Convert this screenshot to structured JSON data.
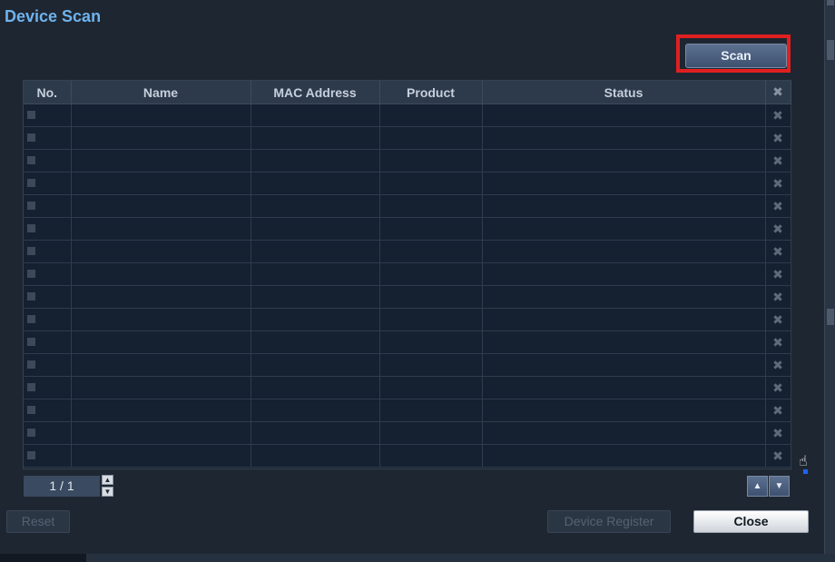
{
  "window": {
    "title": "Device Scan"
  },
  "toolbar": {
    "scan_label": "Scan"
  },
  "table": {
    "headers": {
      "no": "No.",
      "name": "Name",
      "mac": "MAC Address",
      "product": "Product",
      "status": "Status",
      "delete": "✖"
    },
    "rows": [
      {
        "no": "",
        "name": "",
        "mac": "",
        "product": "",
        "status": ""
      },
      {
        "no": "",
        "name": "",
        "mac": "",
        "product": "",
        "status": ""
      },
      {
        "no": "",
        "name": "",
        "mac": "",
        "product": "",
        "status": ""
      },
      {
        "no": "",
        "name": "",
        "mac": "",
        "product": "",
        "status": ""
      },
      {
        "no": "",
        "name": "",
        "mac": "",
        "product": "",
        "status": ""
      },
      {
        "no": "",
        "name": "",
        "mac": "",
        "product": "",
        "status": ""
      },
      {
        "no": "",
        "name": "",
        "mac": "",
        "product": "",
        "status": ""
      },
      {
        "no": "",
        "name": "",
        "mac": "",
        "product": "",
        "status": ""
      },
      {
        "no": "",
        "name": "",
        "mac": "",
        "product": "",
        "status": ""
      },
      {
        "no": "",
        "name": "",
        "mac": "",
        "product": "",
        "status": ""
      },
      {
        "no": "",
        "name": "",
        "mac": "",
        "product": "",
        "status": ""
      },
      {
        "no": "",
        "name": "",
        "mac": "",
        "product": "",
        "status": ""
      },
      {
        "no": "",
        "name": "",
        "mac": "",
        "product": "",
        "status": ""
      },
      {
        "no": "",
        "name": "",
        "mac": "",
        "product": "",
        "status": ""
      },
      {
        "no": "",
        "name": "",
        "mac": "",
        "product": "",
        "status": ""
      },
      {
        "no": "",
        "name": "",
        "mac": "",
        "product": "",
        "status": ""
      }
    ]
  },
  "pager": {
    "page_label": "1 / 1"
  },
  "footer": {
    "reset_label": "Reset",
    "device_register_label": "Device Register",
    "close_label": "Close"
  },
  "icons": {
    "delete": "close-x-icon",
    "spin_up": "spin-up-icon",
    "spin_down": "spin-down-icon",
    "page_up": "arrow-up-icon",
    "page_down": "arrow-down-icon",
    "cursor": "hand-cursor-icon"
  },
  "colors": {
    "title": "#6fb3ee",
    "highlight": "#e02020",
    "background": "#1e2631"
  }
}
